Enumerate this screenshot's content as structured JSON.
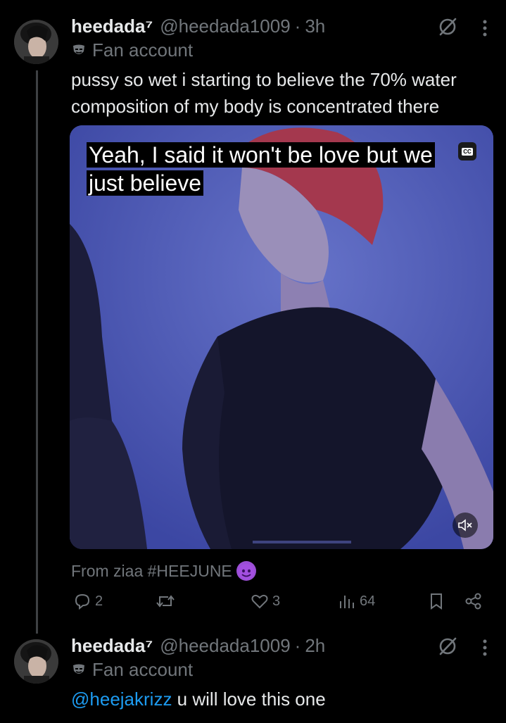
{
  "tweet1": {
    "display_name": "heedada⁷",
    "handle": "@heedada1009",
    "dot": "·",
    "time": "3h",
    "label": "Fan account",
    "text_line1": "pussy so wet i starting to believe the 70% water",
    "text_line2": "composition of my body is concentrated there",
    "media": {
      "caption": "Yeah, I said it won't be love but we just believe",
      "cc_label": "CC"
    },
    "attribution": "From ziaa #HEEJUNE",
    "replies": "2",
    "retweets": "",
    "likes": "3",
    "views": "64"
  },
  "tweet2": {
    "display_name": "heedada⁷",
    "handle": "@heedada1009",
    "dot": "·",
    "time": "2h",
    "label": "Fan account",
    "mention": "@heejakrizz",
    "text": " u will love this one"
  },
  "colors": {
    "background": "#000000",
    "text": "#e7e9ea",
    "secondary": "#71767b",
    "link": "#1d9bf0"
  },
  "icons": [
    "grok-icon",
    "more-icon",
    "fan-account-icon",
    "reply-icon",
    "retweet-icon",
    "like-icon",
    "views-icon",
    "bookmark-icon",
    "share-icon",
    "cc-icon",
    "mute-icon",
    "devil-emoji-icon"
  ]
}
